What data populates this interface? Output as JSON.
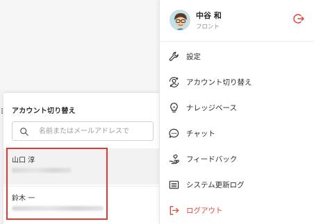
{
  "profile": {
    "name": "中谷 和",
    "role": "フロント"
  },
  "menu": {
    "items": [
      {
        "label": "設定",
        "icon": "wrench-icon"
      },
      {
        "label": "アカウント切り替え",
        "icon": "switch-account-icon"
      },
      {
        "label": "ナレッジベース",
        "icon": "lightbulb-icon"
      },
      {
        "label": "チャット",
        "icon": "chat-bubble-icon"
      },
      {
        "label": "フィードバック",
        "icon": "feedback-hand-icon"
      },
      {
        "label": "システム更新ログ",
        "icon": "changelog-icon"
      },
      {
        "label": "ログアウト",
        "icon": "logout-icon"
      }
    ]
  },
  "account_switch": {
    "title": "アカウント切り替え",
    "search_placeholder": "名前またはメールアドレスで",
    "accounts": [
      {
        "name": "山口 淳"
      },
      {
        "name": "鈴木 一"
      }
    ]
  },
  "colors": {
    "accent_red": "#e0453a",
    "highlight_border": "#e23b2e"
  }
}
